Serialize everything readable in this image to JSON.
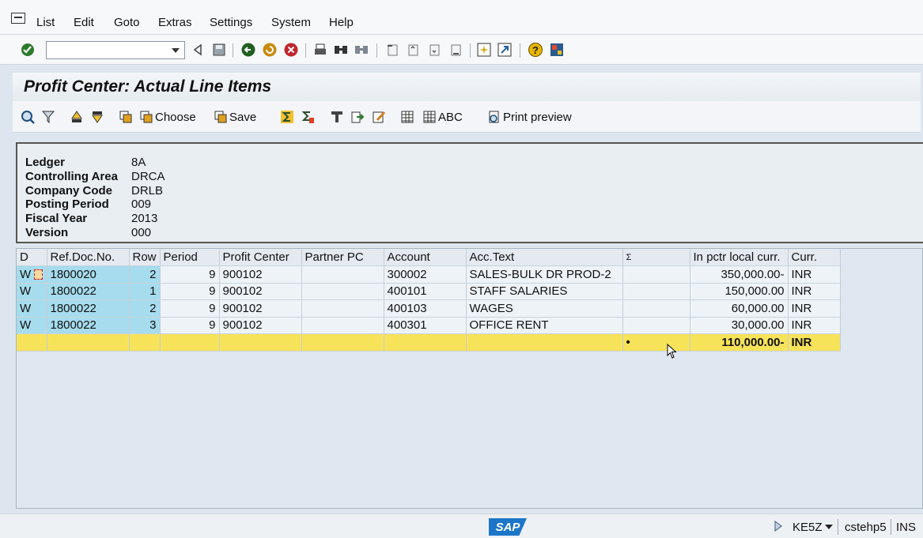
{
  "menu": [
    "List",
    "Edit",
    "Goto",
    "Extras",
    "Settings",
    "System",
    "Help"
  ],
  "page_title": "Profit Center: Actual Line Items",
  "app_toolbar": {
    "choose": "Choose",
    "save": "Save",
    "abc": "ABC",
    "print_preview": "Print preview"
  },
  "header": [
    {
      "label": "Ledger",
      "value": "8A"
    },
    {
      "label": "Controlling Area",
      "value": "DRCA"
    },
    {
      "label": "Company Code",
      "value": "DRLB"
    },
    {
      "label": "Posting Period",
      "value": "009"
    },
    {
      "label": "Fiscal Year",
      "value": "2013"
    },
    {
      "label": "Version",
      "value": "000"
    }
  ],
  "grid": {
    "columns": [
      "D",
      "Ref.Doc.No.",
      "Row",
      "Period",
      "Profit Center",
      "Partner PC",
      "Account",
      "Acc.Text",
      "Σ",
      "In pctr local curr.",
      "Curr."
    ],
    "rows": [
      {
        "d": "W",
        "ref": "1800020",
        "row": "2",
        "period": "9",
        "pc": "900102",
        "partner": "",
        "account": "300002",
        "text": "SALES-BULK DR PROD-2",
        "sigma": "",
        "amount": "350,000.00-",
        "curr": "INR"
      },
      {
        "d": "W",
        "ref": "1800022",
        "row": "1",
        "period": "9",
        "pc": "900102",
        "partner": "",
        "account": "400101",
        "text": "STAFF SALARIES",
        "sigma": "",
        "amount": "150,000.00",
        "curr": "INR"
      },
      {
        "d": "W",
        "ref": "1800022",
        "row": "2",
        "period": "9",
        "pc": "900102",
        "partner": "",
        "account": "400103",
        "text": "WAGES",
        "sigma": "",
        "amount": "60,000.00",
        "curr": "INR"
      },
      {
        "d": "W",
        "ref": "1800022",
        "row": "3",
        "period": "9",
        "pc": "900102",
        "partner": "",
        "account": "400301",
        "text": "OFFICE RENT",
        "sigma": "",
        "amount": "30,000.00",
        "curr": "INR"
      }
    ],
    "total": {
      "sigma": "•",
      "amount": "110,000.00-",
      "curr": "INR"
    }
  },
  "status": {
    "logo": "SAP",
    "transaction": "KE5Z",
    "server": "cstehp5",
    "mode": "INS"
  }
}
